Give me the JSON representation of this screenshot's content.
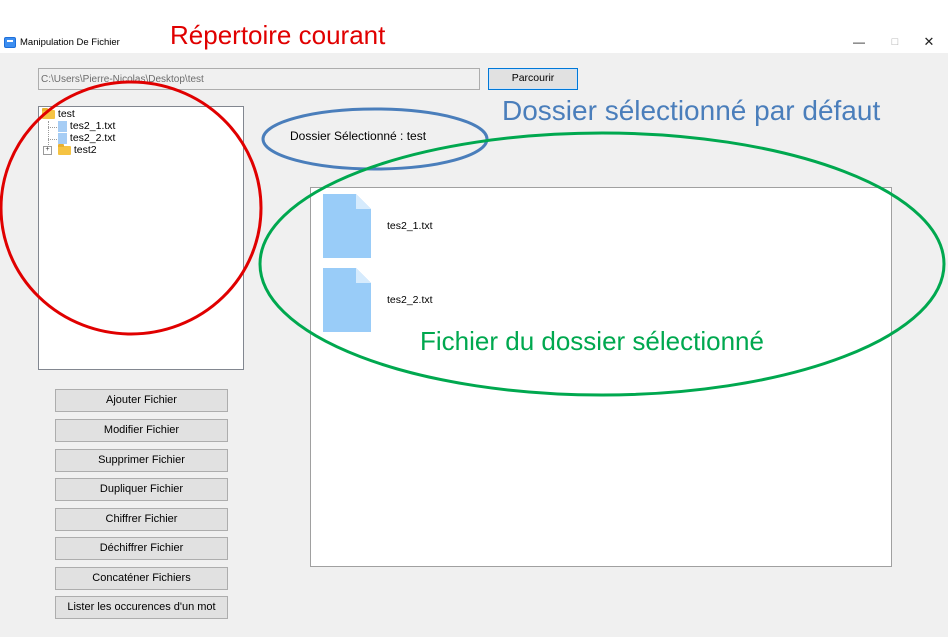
{
  "window": {
    "title": "Manipulation De Fichier",
    "controls": [
      "—",
      "□",
      "✕"
    ]
  },
  "path_bar": {
    "value": "C:\\Users\\Pierre-Nicolas\\Desktop\\test",
    "browse_label": "Parcourir"
  },
  "tree": {
    "root": "test",
    "children": [
      "tes2_1.txt",
      "tes2_2.txt",
      "test2"
    ],
    "expander": "+"
  },
  "selected_folder_label": "Dossier Sélectionné : test",
  "files": [
    {
      "name": "tes2_1.txt",
      "icon": "text-file-icon"
    },
    {
      "name": "tes2_2.txt",
      "icon": "text-file-icon"
    }
  ],
  "actions": [
    "Ajouter Fichier",
    "Modifier Fichier",
    "Supprimer Fichier",
    "Dupliquer Fichier",
    "Chiffrer Fichier",
    "Déchiffrer Fichier",
    "Concaténer Fichiers",
    "Lister les occurences d'un mot"
  ],
  "annotations": {
    "current_directory": "Répertoire courant",
    "default_selected": "Dossier sélectionné par défaut",
    "selected_files": "Fichier du dossier sélectionné"
  },
  "colors": {
    "annotation_red": "#e00000",
    "annotation_blue": "#4a7ebb",
    "annotation_green": "#00a84f",
    "file_icon": "#99ccf8",
    "folder_icon": "#f5c343",
    "focus_border": "#0078d7"
  }
}
